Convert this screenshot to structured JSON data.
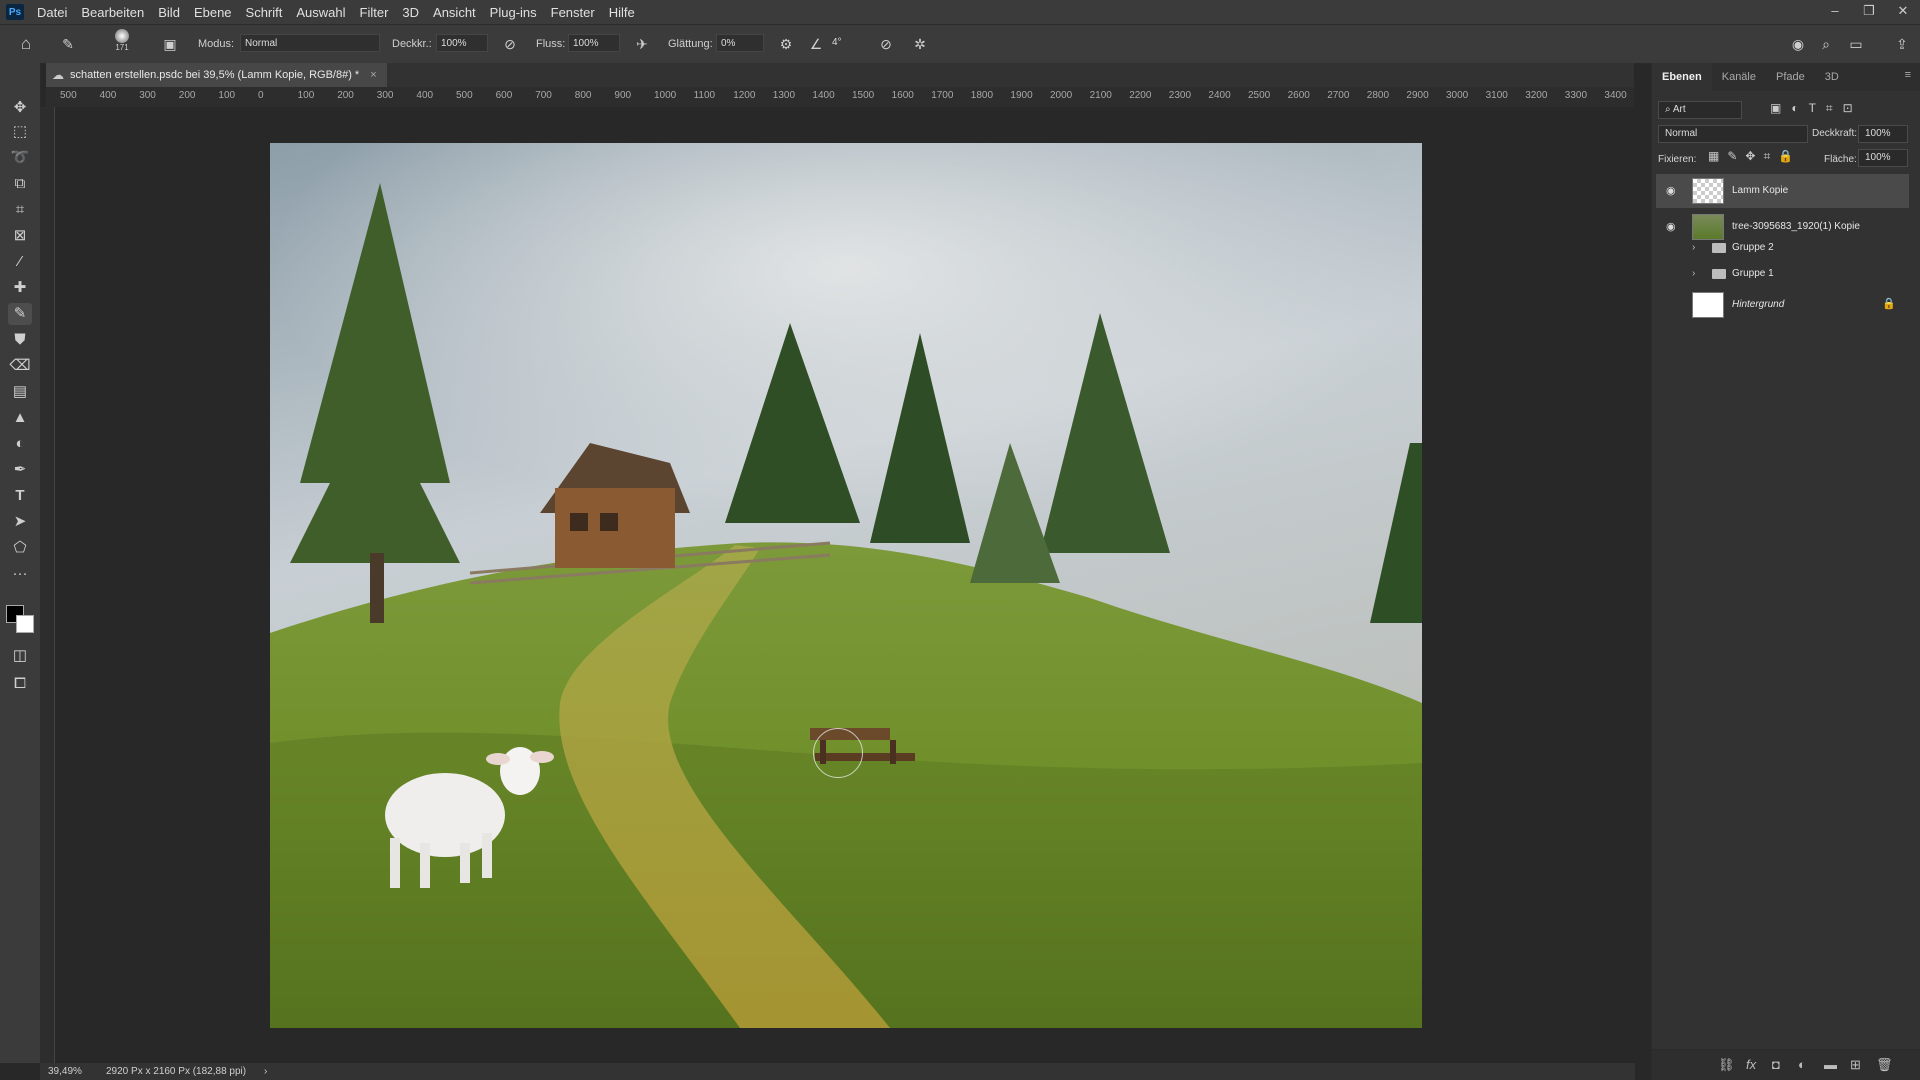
{
  "menu": {
    "logo": "Ps",
    "items": [
      "Datei",
      "Bearbeiten",
      "Bild",
      "Ebene",
      "Schrift",
      "Auswahl",
      "Filter",
      "3D",
      "Ansicht",
      "Plug-ins",
      "Fenster",
      "Hilfe"
    ]
  },
  "window_controls": [
    "–",
    "❐",
    "✕"
  ],
  "options_bar": {
    "brush_size": "171",
    "mode_label": "Modus:",
    "mode_value": "Normal",
    "opacity_label": "Deckkr.:",
    "opacity_value": "100%",
    "flow_label": "Fluss:",
    "flow_value": "100%",
    "smoothing_label": "Glättung:",
    "smoothing_value": "0%",
    "angle_value": "4°"
  },
  "document_tab": {
    "title": "schatten erstellen.psdc bei 39,5% (Lamm Kopie, RGB/8#) *",
    "close": "×"
  },
  "ruler_top": [
    "500",
    "400",
    "300",
    "200",
    "100",
    "0",
    "100",
    "200",
    "300",
    "400",
    "500",
    "600",
    "700",
    "800",
    "900",
    "1000",
    "1100",
    "1200",
    "1300",
    "1400",
    "1500",
    "1600",
    "1700",
    "1800",
    "1900",
    "2000",
    "2100",
    "2200",
    "2300",
    "2400",
    "2500",
    "2600",
    "2700",
    "2800",
    "2900",
    "3000",
    "3100",
    "3200",
    "3300",
    "3400"
  ],
  "status_bar": {
    "zoom": "39,49%",
    "doc_info": "2920 Px x 2160 Px (182,88 ppi)",
    "arrow": "›"
  },
  "layers_panel": {
    "tabs": [
      "Ebenen",
      "Kanäle",
      "Pfade",
      "3D"
    ],
    "filter_label": "Art",
    "blend_mode": "Normal",
    "opacity_label": "Deckkraft:",
    "opacity_value": "100%",
    "lock_label": "Fixieren:",
    "fill_label": "Fläche:",
    "fill_value": "100%",
    "layers": [
      {
        "name": "Lamm Kopie",
        "visible": true,
        "selected": true
      },
      {
        "name": "tree-3095683_1920(1) Kopie",
        "visible": true,
        "selected": false
      },
      {
        "name": "Gruppe 2",
        "visible": false,
        "group": true
      },
      {
        "name": "Gruppe 1",
        "visible": false,
        "group": true
      },
      {
        "name": "Hintergrund",
        "visible": false,
        "locked": true
      }
    ]
  },
  "colors": {
    "ui_dark": "#282828",
    "ui_panel": "#323232",
    "ui_bar": "#3b3b3b",
    "selection": "#4a4a4a",
    "ps_blue": "#4aa9ff"
  }
}
